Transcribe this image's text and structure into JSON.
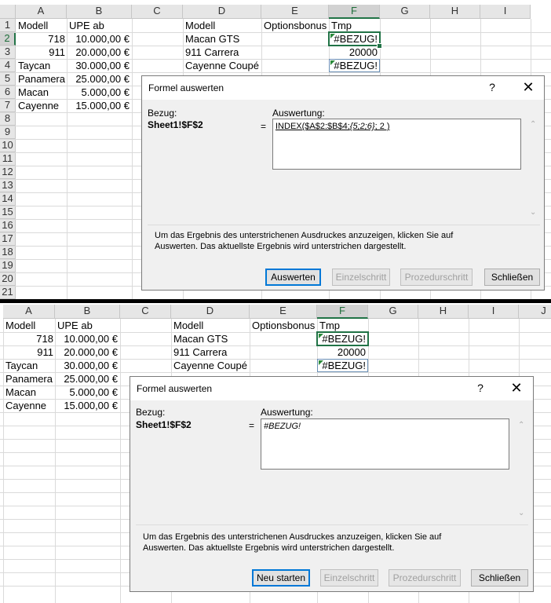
{
  "columns_top": [
    "A",
    "B",
    "C",
    "D",
    "E",
    "F",
    "G",
    "H",
    "I"
  ],
  "columns_bottom": [
    "A",
    "B",
    "C",
    "D",
    "E",
    "F",
    "G",
    "H",
    "I",
    "J"
  ],
  "rows": [
    "1",
    "2",
    "3",
    "4",
    "5",
    "6",
    "7",
    "8",
    "9",
    "10",
    "11",
    "12",
    "13",
    "14",
    "15",
    "16",
    "17",
    "18",
    "19",
    "20",
    "21"
  ],
  "sheet": {
    "a1": "Modell",
    "b1": "UPE ab",
    "a2": "718",
    "b2": "10.000,00 €",
    "a3": "911",
    "b3": "20.000,00 €",
    "a4": "Taycan",
    "b4": "30.000,00 €",
    "a5": "Panamera",
    "b5": "25.000,00 €",
    "a6": "Macan",
    "b6": "5.000,00 €",
    "a7": "Cayenne",
    "b7": "15.000,00 €",
    "d1": "Modell",
    "e1": "Optionsbonus",
    "f1": "Tmp",
    "d2": "Macan GTS",
    "f2": "#BEZUG!",
    "d3": "911 Carrera",
    "f3": "20000",
    "d4": "Cayenne Coupé",
    "f4": "#BEZUG!"
  },
  "dialog_top": {
    "title": "Formel auswerten",
    "help": "?",
    "close": "✕",
    "bezug_label": "Bezug:",
    "bezug_value": "Sheet1!$F$2",
    "equals": "=",
    "auswertung_label": "Auswertung:",
    "eval_prefix": "INDEX($A$2:$B$4;",
    "eval_italic": "{5;2;6}",
    "eval_suffix": "; 2 )",
    "info_line1": "Um das Ergebnis des unterstrichenen Ausdruckes anzuzeigen, klicken Sie auf",
    "info_line2": "Auswerten. Das aktuellste Ergebnis wird unterstrichen dargestellt.",
    "btn_primary": "Auswerten",
    "btn_einzelschritt": "Einzelschritt",
    "btn_prozedurschritt": "Prozedurschritt",
    "btn_schliessen": "Schließen"
  },
  "dialog_bottom": {
    "title": "Formel auswerten",
    "help": "?",
    "close": "✕",
    "bezug_label": "Bezug:",
    "bezug_value": "Sheet1!$F$2",
    "equals": "=",
    "auswertung_label": "Auswertung:",
    "eval_value": "#BEZUG!",
    "info_line1": "Um das Ergebnis des unterstrichenen Ausdruckes anzuzeigen, klicken Sie auf",
    "info_line2": "Auswerten. Das aktuellste Ergebnis wird unterstrichen dargestellt.",
    "btn_primary": "Neu starten",
    "btn_einzelschritt": "Einzelschritt",
    "btn_prozedurschritt": "Prozedurschritt",
    "btn_schliessen": "Schließen"
  },
  "colors": {
    "accent": "#217346",
    "error_triangle": "#2a8a3a",
    "focus": "#0078d7"
  },
  "icons": {
    "help": "help-icon",
    "close": "close-icon",
    "scroll_up": "chevron-up-icon",
    "scroll_down": "chevron-down-icon"
  }
}
